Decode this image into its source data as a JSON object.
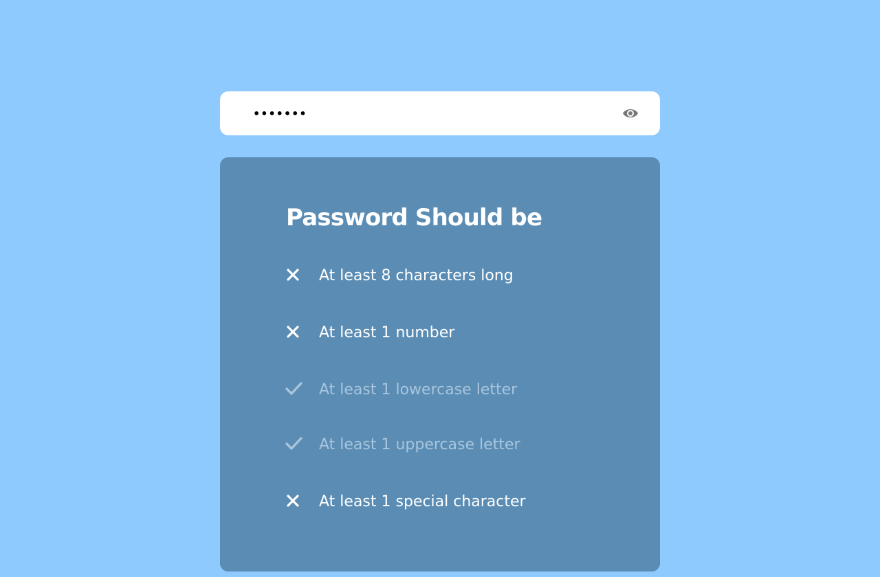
{
  "password_field": {
    "value": "•••••••",
    "toggle_icon": "eye-icon"
  },
  "requirements_panel": {
    "title": "Password Should be",
    "items": [
      {
        "label": "At least 8 characters long",
        "status": "invalid",
        "icon": "x-icon"
      },
      {
        "label": "At least 1 number",
        "status": "invalid",
        "icon": "x-icon"
      },
      {
        "label": "At least 1 lowercase letter",
        "status": "valid",
        "icon": "check-icon"
      },
      {
        "label": "At least 1 uppercase letter",
        "status": "valid",
        "icon": "check-icon"
      },
      {
        "label": "At least 1 special character",
        "status": "invalid",
        "icon": "x-icon"
      }
    ]
  },
  "colors": {
    "background": "#8ecafe",
    "panel": "#5a8cb4",
    "unmet_text": "#ffffff",
    "met_text": "#a8c5dd",
    "eye_icon": "#777777"
  }
}
